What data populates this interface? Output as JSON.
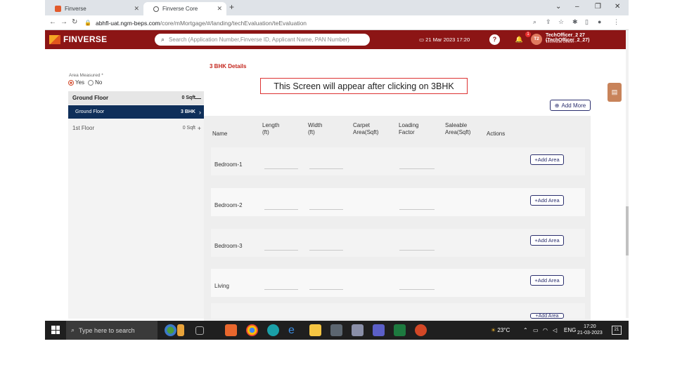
{
  "browser": {
    "tabs": [
      {
        "label": "Finverse",
        "active": false
      },
      {
        "label": "Finverse Core",
        "active": true
      }
    ],
    "url_host": "abhfl-uat.ngm-beps.com",
    "url_path": "/core/mMortgage/#/landing/techEvaluation/teEvaluation"
  },
  "header": {
    "brand": "FINVERSE",
    "search_placeholder": "Search (Application Number,Finverse ID, Applicant Name, PAN Number)",
    "date": "21 Mar 2023 17:20",
    "notification_count": "1",
    "avatar_initials": "T2",
    "user_name": "TechOfficer_2 27 (TechOfficer_2_27)",
    "user_role": "Technical Officer"
  },
  "form": {
    "area_measured_label": "Area Measured *",
    "yes_label": "Yes",
    "no_label": "No",
    "selected": "Yes"
  },
  "floors": [
    {
      "label": "Ground Floor",
      "value": "0 Sqft",
      "toggle": "—",
      "style": "header"
    },
    {
      "label": "Ground Floor",
      "value": "3 BHK",
      "toggle": "›",
      "style": "selected"
    },
    {
      "label": "1st Floor",
      "value": "0 Sqft",
      "toggle": "+",
      "style": "normal"
    }
  ],
  "details": {
    "title": "3 BHK Details",
    "add_more": "Add More",
    "columns": [
      "Name",
      "Length\n(ft)",
      "Width\n(ft)",
      "Carpet\nArea(Sqft)",
      "Loading\nFactor",
      "Saleable\nArea(Sqft)",
      "Actions"
    ],
    "rows": [
      {
        "name": "Bedroom-1",
        "action": "+Add Area"
      },
      {
        "name": "Bedroom-2",
        "action": "+Add Area"
      },
      {
        "name": "Bedroom-3",
        "action": "+Add Area"
      },
      {
        "name": "Living",
        "action": "+Add Area"
      },
      {
        "name": "",
        "action": "+Add Area"
      }
    ]
  },
  "callout": "This Screen will appear after clicking on 3BHK",
  "taskbar": {
    "search_placeholder": "Type here to search",
    "weather": "23°C",
    "language": "ENG",
    "time": "17:20",
    "date": "21-03-2023",
    "notif_count": "21"
  },
  "colors": {
    "brand": "#8c1515",
    "accent": "#c4261d",
    "selected_floor": "#0f2f5a",
    "button": "#2b2f6e"
  }
}
